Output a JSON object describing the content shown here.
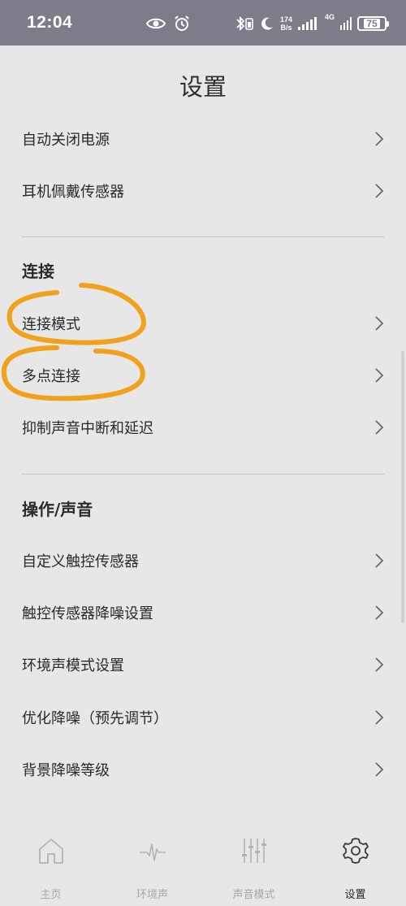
{
  "status_bar": {
    "time": "12:04",
    "net_speed_value": "174",
    "net_speed_unit": "B/s",
    "network": "4G",
    "battery": "75"
  },
  "header": {
    "title": "设置"
  },
  "top_items": [
    {
      "label": "自动关闭电源"
    },
    {
      "label": "耳机佩戴传感器"
    }
  ],
  "sections": [
    {
      "title": "连接",
      "items": [
        {
          "label": "连接模式"
        },
        {
          "label": "多点连接"
        },
        {
          "label": "抑制声音中断和延迟"
        }
      ]
    },
    {
      "title": "操作/声音",
      "items": [
        {
          "label": "自定义触控传感器"
        },
        {
          "label": "触控传感器降噪设置"
        },
        {
          "label": "环境声模式设置"
        },
        {
          "label": "优化降噪（预先调节）"
        },
        {
          "label": "背景降噪等级"
        }
      ]
    }
  ],
  "bottom_nav": [
    {
      "label": "主页",
      "icon": "home-icon"
    },
    {
      "label": "环境声",
      "icon": "pulse-icon"
    },
    {
      "label": "声音模式",
      "icon": "equalizer-icon"
    },
    {
      "label": "设置",
      "icon": "gear-icon",
      "active": true
    }
  ],
  "colors": {
    "background": "#e7e7e7",
    "status_bar": "#7c7d89",
    "annotation": "#f0a21c",
    "inactive_nav": "#a8a8a8"
  }
}
